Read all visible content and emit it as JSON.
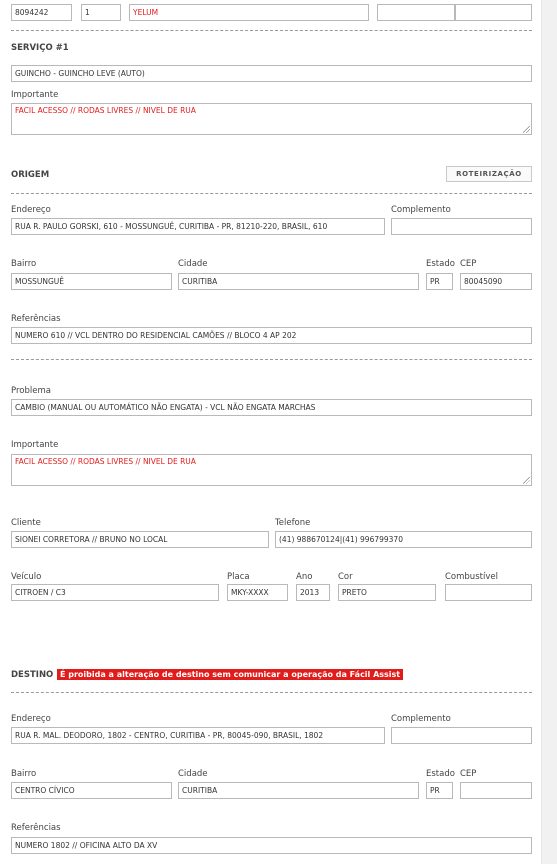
{
  "top": {
    "field1": "8094242",
    "field2": "1",
    "produto": "YELUM",
    "field4": "",
    "field5": ""
  },
  "servico": {
    "title": "SERVIÇO #1",
    "tipo": "GUINCHO - GUINCHO LEVE (AUTO)",
    "importante_label": "Importante",
    "importante": "FACIL ACESSO // RODAS LIVRES // NIVEL DE RUA"
  },
  "origem": {
    "title": "ORIGEM",
    "button": "ROTEIRIZAÇÃO",
    "endereco_label": "Endereço",
    "endereco": "RUA R. PAULO GORSKI, 610 - MOSSUNGUÊ, CURITIBA - PR, 81210-220, BRASIL, 610",
    "complemento_label": "Complemento",
    "complemento": "",
    "bairro_label": "Bairro",
    "bairro": "MOSSUNGUÊ",
    "cidade_label": "Cidade",
    "cidade": "CURITIBA",
    "estado_label": "Estado",
    "estado": "PR",
    "cep_label": "CEP",
    "cep": "80045090",
    "referencias_label": "Referências",
    "referencias": "NUMERO 610 // VCL DENTRO DO RESIDENCIAL CAMÕES // BLOCO 4 AP 202"
  },
  "problema": {
    "problema_label": "Problema",
    "problema": "CAMBIO (MANUAL OU AUTOMÁTICO NÃO ENGATA) - VCL NÃO ENGATA MARCHAS",
    "importante_label": "Importante",
    "importante": "FACIL ACESSO // RODAS LIVRES // NIVEL DE RUA",
    "cliente_label": "Cliente",
    "cliente": "SIONEI CORRETORA // BRUNO NO LOCAL",
    "telefone_label": "Telefone",
    "telefone": "(41) 988670124|(41) 996799370",
    "veiculo_label": "Veículo",
    "veiculo": "CITROEN / C3",
    "placa_label": "Placa",
    "placa": "MKY-XXXX",
    "ano_label": "Ano",
    "ano": "2013",
    "cor_label": "Cor",
    "cor": "PRETO",
    "combustivel_label": "Combustível",
    "combustivel": ""
  },
  "destino": {
    "title": "DESTINO",
    "warning": "É proibida a alteração de destino sem comunicar a operação da Fácil Assist",
    "endereco_label": "Endereço",
    "endereco": "RUA R. MAL. DEODORO, 1802 - CENTRO, CURITIBA - PR, 80045-090, BRASIL, 1802",
    "complemento_label": "Complemento",
    "complemento": "",
    "bairro_label": "Bairro",
    "bairro": "CENTRO CÍVICO",
    "cidade_label": "Cidade",
    "cidade": "CURITIBA",
    "estado_label": "Estado",
    "estado": "PR",
    "cep_label": "CEP",
    "cep": "",
    "referencias_label": "Referências",
    "referencias": "NUMERO 1802 // OFICINA ALTO DA XV"
  }
}
